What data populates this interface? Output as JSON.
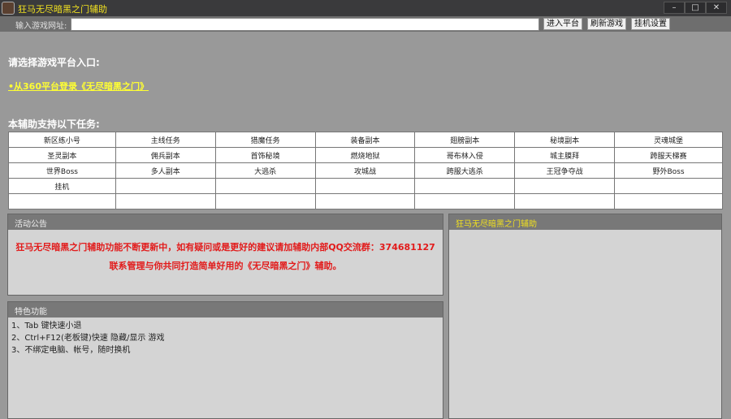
{
  "window": {
    "title": "狂马无尽暗黑之门辅助",
    "minimize": "–",
    "maximize": "□",
    "close": "✕"
  },
  "toolbar": {
    "url_label": "输入游戏网址:",
    "url_value": "",
    "enter": "进入平台",
    "refresh": "刷新游戏",
    "settings": "挂机设置"
  },
  "platform": {
    "heading": "请选择游戏平台入口:",
    "link": "•从360平台登录《无尽暗黑之门》"
  },
  "tasks": {
    "heading": "本辅助支持以下任务:",
    "rows": [
      [
        "新区练小号",
        "主线任务",
        "猎魔任务",
        "装备副本",
        "翅膀副本",
        "秘境副本",
        "灵魂城堡"
      ],
      [
        "圣灵副本",
        "佣兵副本",
        "首饰秘境",
        "燃烧地狱",
        "哥布林入侵",
        "城主膜拜",
        "跨服天梯赛"
      ],
      [
        "世界Boss",
        "多人副本",
        "大逃杀",
        "攻城战",
        "跨服大逃杀",
        "王冠争夺战",
        "野外Boss"
      ],
      [
        "挂机",
        "",
        "",
        "",
        "",
        "",
        ""
      ],
      [
        "",
        "",
        "",
        "",
        "",
        "",
        ""
      ]
    ]
  },
  "notice": {
    "title": "活动公告",
    "line1": "狂马无尽暗黑之门辅助功能不断更新中，如有疑问或是更好的建议请加辅助内部QQ交流群：374681127",
    "line2": "联系管理与你共同打造简单好用的《无尽暗黑之门》辅助。"
  },
  "features": {
    "title": "特色功能",
    "items": [
      "1、Tab 键快速小退",
      "2、Ctrl+F12(老板键)快速 隐藏/显示 游戏",
      "3、不绑定电脑、帐号，随时换机"
    ]
  },
  "side": {
    "title": "狂马无尽暗黑之门辅助"
  }
}
